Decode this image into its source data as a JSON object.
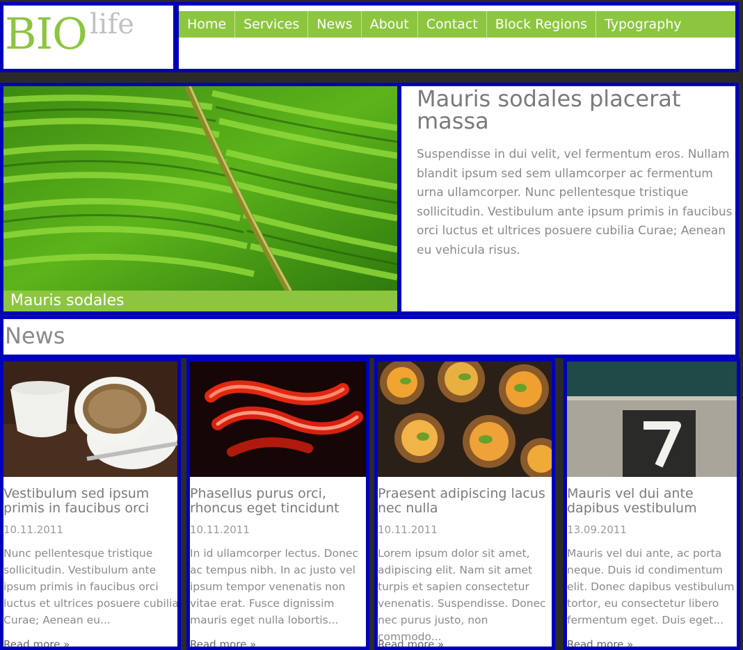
{
  "header": {
    "logo_main": "BIO",
    "logo_suffix": "life",
    "nav": [
      "Home",
      "Services",
      "News",
      "About",
      "Contact",
      "Block Regions",
      "Typography"
    ]
  },
  "featured": {
    "caption": "Mauris sodales",
    "title": "Mauris sodales placerat massa",
    "body": "Suspendisse in dui velit, vel fermentum eros. Nullam blandit ipsum sed sem ullamcorper ac fermentum urna ullamcorper. Nunc pellentesque tristique sollicitudin. Vestibulum ante ipsum primis in faucibus orci luctus et ultrices posuere cubilia Curae; Aenean eu vehicula risus."
  },
  "news": {
    "heading": "News",
    "items": [
      {
        "title": "Vestibulum sed ipsum primis in faucibus orci",
        "date": "10.11.2011",
        "excerpt": "Nunc pellentesque tristique sollicitudin. Vestibulum ante ipsum primis in faucibus orci luctus et ultrices posuere cubilia Curae; Aenean eu...",
        "more": "Read more »",
        "image": "coffee-cups"
      },
      {
        "title": "Phasellus purus orci, rhoncus eget tincidunt",
        "date": "10.11.2011",
        "excerpt": "In id ullamcorper lectus. Donec ac tempus nibh. In ac justo vel ipsum tempor venenatis non vitae erat. Fusce dignissim mauris eget nulla lobortis...",
        "more": "Read more »",
        "image": "red-light-streaks"
      },
      {
        "title": "Praesent adipiscing lacus nec nulla",
        "date": "10.11.2011",
        "excerpt": "Lorem ipsum dolor sit amet, adipiscing elit. Nam sit amet turpis et sapien consectetur venenatis. Suspendisse. Donec nec purus justo, non commodo...",
        "more": "Read more »",
        "image": "fruit-tarts"
      },
      {
        "title": "Mauris vel dui ante dapibus vestibulum",
        "date": "13.09.2011",
        "excerpt": "Mauris vel dui ante, ac porta neque. Duis id condimentum elit. Donec dapibus vestibulum tortor, eu consectetur libero fermentum eget. Duis eget...",
        "more": "Read more »",
        "image": "number-seven-sign"
      }
    ]
  },
  "colors": {
    "accent": "#8cc63f",
    "frame": "#0000b8",
    "text": "#8a8a8a"
  }
}
